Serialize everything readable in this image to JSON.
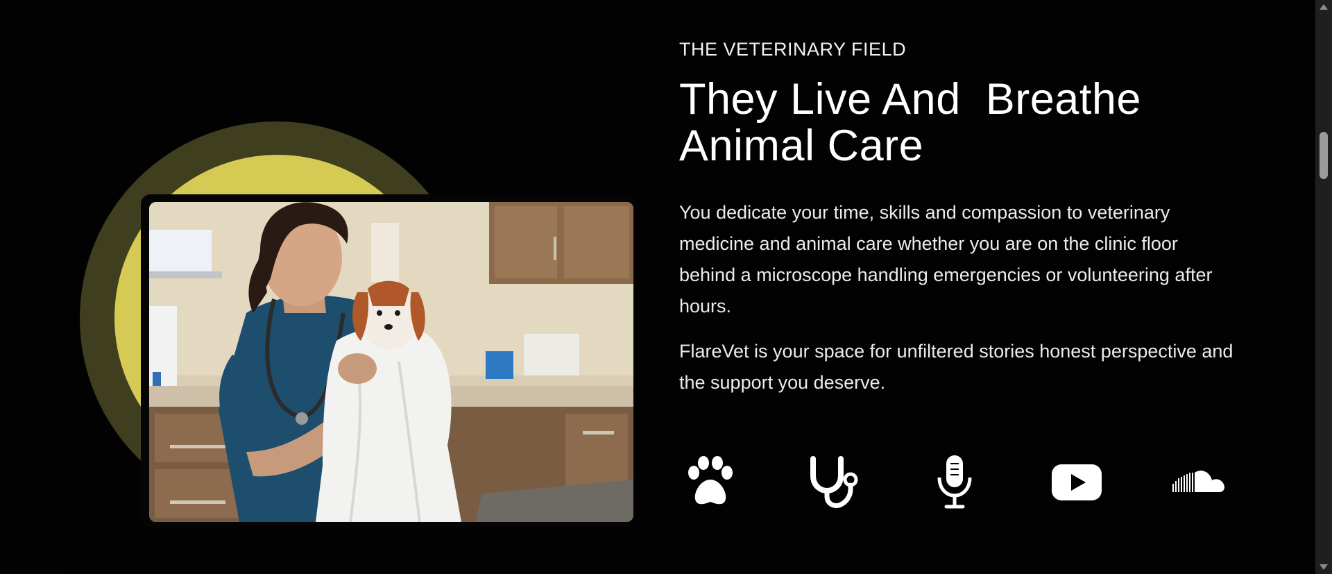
{
  "section": {
    "eyebrow": "THE VETERINARY FIELD",
    "headline": "They Live And  Breathe\nAnimal Care",
    "paragraph_1": "You dedicate your time, skills and compassion to veterinary medicine and animal care whether you are on the clinic floor behind a microscope handling emergencies or volunteering after hours.",
    "paragraph_2": "FlareVet is your space for unfiltered stories honest perspective and the support you deserve."
  },
  "icons": [
    {
      "name": "paw-icon"
    },
    {
      "name": "stethoscope-icon"
    },
    {
      "name": "microphone-icon"
    },
    {
      "name": "youtube-icon"
    },
    {
      "name": "soundcloud-icon"
    }
  ],
  "colors": {
    "background": "#000000",
    "accent_yellow": "#d5cb54",
    "accent_olive": "#3f3e1f",
    "text": "#ffffff"
  }
}
